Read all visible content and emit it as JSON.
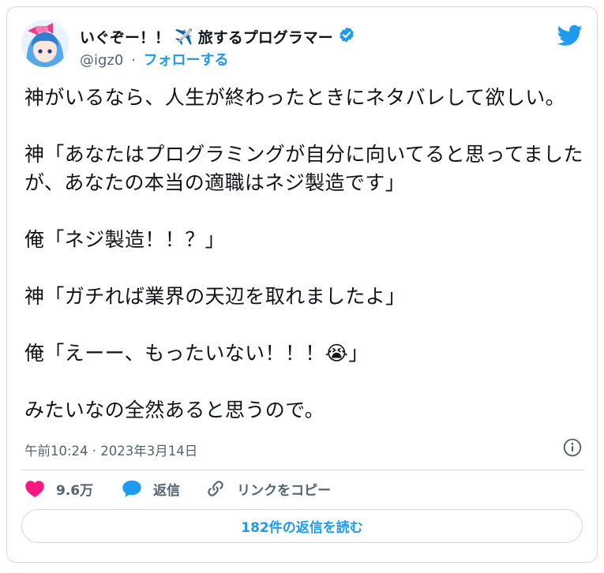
{
  "author": {
    "name": "いぐぞー！！",
    "name_suffix": "旅するプログラマー",
    "plane_emoji": "✈️",
    "handle": "@igz0",
    "separator": "·",
    "follow_label": "フォローする"
  },
  "tweet": {
    "paragraphs": [
      "神がいるなら、人生が終わったときにネタバレして欲しい。",
      "神「あなたはプログラミングが自分に向いてると思ってましたが、あなたの本当の適職はネジ製造です」",
      "俺「ネジ製造！！？」",
      "神「ガチれば業界の天辺を取れましたよ」",
      "俺「えーー、もったいない！！！😭」",
      "みたいなの全然あると思うので。"
    ],
    "timestamp": "午前10:24 · 2023年3月14日"
  },
  "actions": {
    "like_count": "9.6万",
    "reply_label": "返信",
    "copy_link_label": "リンクをコピー",
    "read_replies_label": "182件の返信を読む"
  },
  "icons": {
    "verified": "verified-badge-icon",
    "bird": "twitter-bird-icon",
    "info": "info-icon",
    "heart": "heart-icon",
    "reply": "reply-bubble-icon",
    "link": "link-icon"
  },
  "colors": {
    "accent": "#1d9bf0",
    "like": "#f91880",
    "text": "#0f1419",
    "muted": "#536471",
    "border": "#cfd9de"
  }
}
